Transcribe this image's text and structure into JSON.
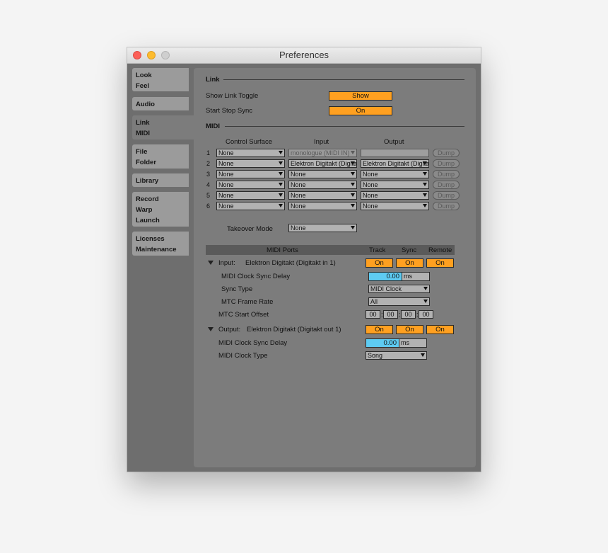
{
  "window": {
    "title": "Preferences"
  },
  "sidebar": {
    "tabs": [
      {
        "lines": [
          "Look",
          "Feel"
        ]
      },
      {
        "lines": [
          "Audio"
        ]
      },
      {
        "lines": [
          "Link",
          "MIDI"
        ]
      },
      {
        "lines": [
          "File",
          "Folder"
        ]
      },
      {
        "lines": [
          "Library"
        ]
      },
      {
        "lines": [
          "Record",
          "Warp",
          "Launch"
        ]
      },
      {
        "lines": [
          "Licenses",
          "Maintenance"
        ]
      }
    ]
  },
  "link": {
    "heading": "Link",
    "show_toggle_label": "Show Link Toggle",
    "show_toggle_value": "Show",
    "start_stop_label": "Start Stop Sync",
    "start_stop_value": "On"
  },
  "midi": {
    "heading": "MIDI",
    "columns": {
      "control_surface": "Control Surface",
      "input": "Input",
      "output": "Output"
    },
    "rows": [
      {
        "num": "1",
        "surface": "None",
        "input": "monologue (MIDI IN)",
        "output": "",
        "dump": "Dump"
      },
      {
        "num": "2",
        "surface": "None",
        "input": "Elektron Digitakt (Digitakt in 1)",
        "output": "Elektron Digitakt (Digitakt out 1)",
        "dump": "Dump"
      },
      {
        "num": "3",
        "surface": "None",
        "input": "None",
        "output": "None",
        "dump": "Dump"
      },
      {
        "num": "4",
        "surface": "None",
        "input": "None",
        "output": "None",
        "dump": "Dump"
      },
      {
        "num": "5",
        "surface": "None",
        "input": "None",
        "output": "None",
        "dump": "Dump"
      },
      {
        "num": "6",
        "surface": "None",
        "input": "None",
        "output": "None",
        "dump": "Dump"
      }
    ],
    "takeover_label": "Takeover Mode",
    "takeover_value": "None"
  },
  "ports": {
    "header": {
      "ports": "MIDI Ports",
      "track": "Track",
      "sync": "Sync",
      "remote": "Remote"
    },
    "input": {
      "kind": "Input:",
      "name": "Elektron Digitakt (Digitakt in 1)",
      "track": "On",
      "sync": "On",
      "remote": "On",
      "clock_delay_label": "MIDI Clock Sync Delay",
      "clock_delay_value": "0.00",
      "clock_delay_unit": "ms",
      "sync_type_label": "Sync Type",
      "sync_type_value": "MIDI Clock",
      "mtc_rate_label": "MTC Frame Rate",
      "mtc_rate_value": "All",
      "mtc_offset_label": "MTC Start Offset",
      "mtc_offset": [
        "00",
        "00",
        "00",
        "00"
      ]
    },
    "output": {
      "kind": "Output:",
      "name": "Elektron Digitakt (Digitakt out 1)",
      "track": "On",
      "sync": "On",
      "remote": "On",
      "clock_delay_label": "MIDI Clock Sync Delay",
      "clock_delay_value": "0.00",
      "clock_delay_unit": "ms",
      "clock_type_label": "MIDI Clock Type",
      "clock_type_value": "Song"
    }
  }
}
